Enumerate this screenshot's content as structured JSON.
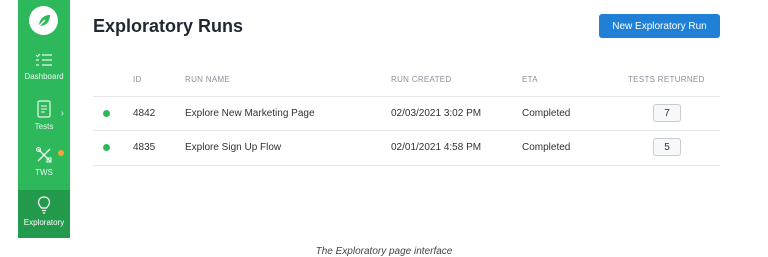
{
  "sidebar": {
    "items": [
      {
        "label": "Dashboard",
        "icon": "list-check-icon"
      },
      {
        "label": "Tests",
        "icon": "document-icon"
      },
      {
        "label": "TWS",
        "icon": "tools-icon"
      },
      {
        "label": "Exploratory",
        "icon": "lightbulb-icon",
        "active": true
      }
    ],
    "logo_icon": "leaf-icon",
    "accent_color": "#2eb85c",
    "notification_color": "#f3a33a"
  },
  "header": {
    "title": "Exploratory Runs",
    "new_run_label": "New Exploratory Run"
  },
  "table": {
    "columns": [
      "ID",
      "RUN NAME",
      "RUN CREATED",
      "ETA",
      "TESTS RETURNED"
    ],
    "rows": [
      {
        "id": "4842",
        "name": "Explore New Marketing Page",
        "created": "02/03/2021 3:02 PM",
        "eta": "Completed",
        "tests": "7"
      },
      {
        "id": "4835",
        "name": "Explore Sign Up Flow",
        "created": "02/01/2021 4:58 PM",
        "eta": "Completed",
        "tests": "5"
      }
    ]
  },
  "caption": "The Exploratory page interface"
}
